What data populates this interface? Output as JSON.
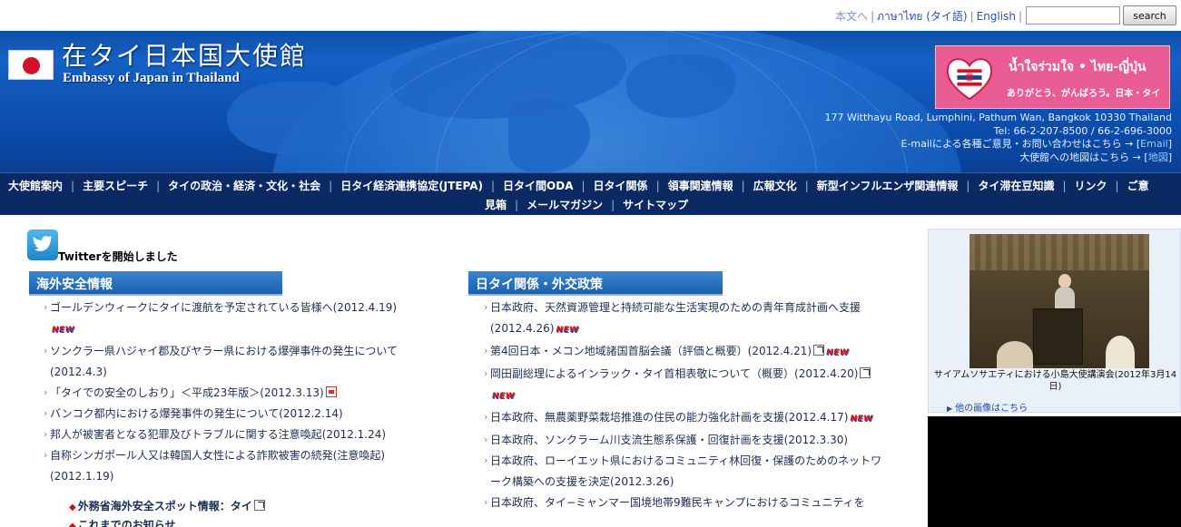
{
  "topbar": {
    "links": [
      "本文へ",
      "ภาษาไทย (タイ語)",
      "English"
    ],
    "search_button": "search",
    "search_placeholder": ""
  },
  "header": {
    "title_jp": "在タイ日本国大使館",
    "title_en": "Embassy of Japan in Thailand",
    "banner": {
      "thai_text": "น้ำใจร่วมใจ • ไทย-ญี่ปุ่น",
      "jp_text": "ありがとう、がんばろう。日本・タイ"
    },
    "contact": {
      "address": "177 Witthayu Road, Lumphini, Pathum Wan, Bangkok 10330 Thailand",
      "tel": "Tel: 66-2-207-8500 / 66-2-696-3000",
      "email_line": "E-mailによる各種ご意見・お問い合わせはこちら → [",
      "email_link": "Email",
      "map_line": "大使館への地図はこちら → [",
      "map_link": "地図",
      "close_bracket": "]"
    }
  },
  "nav": {
    "row1": [
      "大使館案内",
      "主要スピーチ",
      "タイの政治・経済・文化・社会",
      "日タイ経済連携協定(JTEPA)",
      "日タイ間ODA",
      "日タイ関係",
      "領事関連情報",
      "広報文化",
      "新型インフルエンザ関連情報",
      "タイ滞在豆知識",
      "リンク",
      "ご意"
    ],
    "row2": [
      "見箱",
      "メールマガジン",
      "サイトマップ"
    ]
  },
  "twitter": {
    "text": "Twitterを開始しました"
  },
  "safety": {
    "heading": "海外安全情報",
    "items": [
      {
        "text": "ゴールデンウィークにタイに渡航を予定されている皆様へ(2012.4.19)",
        "badge": "NEW"
      },
      {
        "text": "ソンクラー県ハジャイ郡及びヤラー県における爆弾事件の発生について(2012.4.3)",
        "badge": ""
      },
      {
        "text": "「タイでの安全のしおり」＜平成23年版＞(2012.3.13)",
        "badge": ""
      },
      {
        "text": "バンコク都内における爆発事件の発生について(2012.2.14)",
        "badge": ""
      },
      {
        "text": "邦人が被害者となる犯罪及びトラブルに関する注意喚起(2012.1.24)",
        "badge": ""
      },
      {
        "text": "自称シンガポール人又は韓国人女性による詐欺被害の続発(注意喚起)(2012.1.19)",
        "badge": ""
      }
    ],
    "spot_info": "外務省海外安全スポット情報：タイ",
    "previous": "これまでのお知らせ"
  },
  "relations": {
    "heading": "日タイ関係・外交政策",
    "items": [
      {
        "text": "日本政府、天然資源管理と持続可能な生活実現のための青年育成計画へ支援(2012.4.26)",
        "badge": "NEW"
      },
      {
        "text": "第4回日本・メコン地域諸国首脳会議（評価と概要）(2012.4.21)",
        "badge": "NEW"
      },
      {
        "text": "岡田副総理によるインラック・タイ首相表敬について（概要）(2012.4.20)",
        "badge": "NEW"
      },
      {
        "text": "日本政府、無農薬野菜栽培推進の住民の能力強化計画を支援(2012.4.17)",
        "badge": "NEW"
      },
      {
        "text": "日本政府、ソンクラーム川支流生態系保護・回復計画を支援(2012.3.30)",
        "badge": ""
      },
      {
        "text": "日本政府、ローイエット県におけるコミュニティ林回復・保護のためのネットワーク構築への支援を決定(2012.3.26)",
        "badge": ""
      },
      {
        "text": "日本政府、タイ−ミャンマー国境地帯9難民キャンプにおけるコミュニティを",
        "badge": ""
      }
    ]
  },
  "sidebar": {
    "photo_caption": "サイアムソサエティにおける小島大使講演会(2012年3月14日)",
    "more_photos": "他の画像はこちら"
  },
  "colors": {
    "header_blue": "#1561c4",
    "nav_bg": "#0b2a63",
    "section_head": "#2a72c0",
    "new_badge": "#d6101a"
  }
}
